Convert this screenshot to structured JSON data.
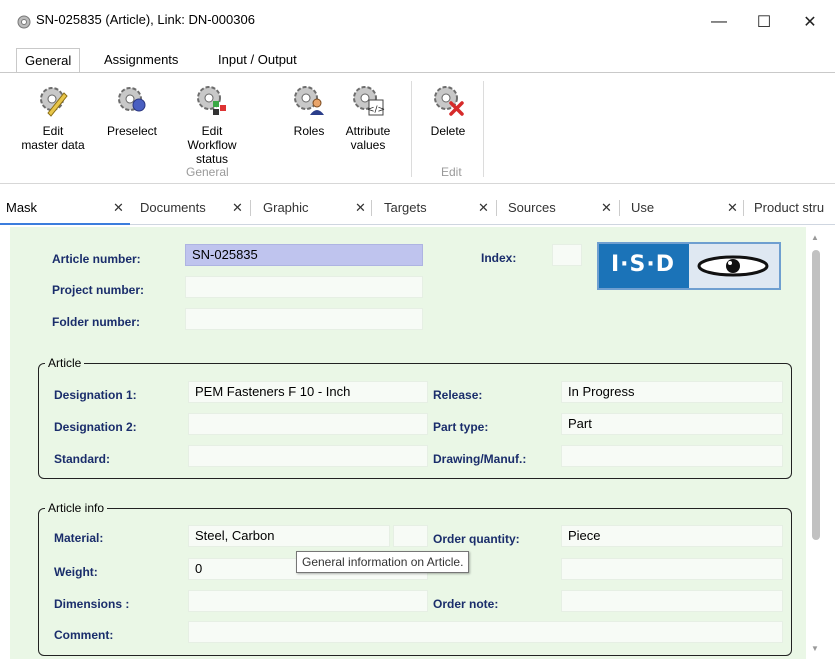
{
  "window": {
    "title": "SN-025835 (Article), Link: DN-000306",
    "minimize_glyph": "—",
    "maximize_glyph": "☐",
    "close_glyph": "✕"
  },
  "ribbon": {
    "tabs": [
      "General",
      "Assignments",
      "Input / Output"
    ],
    "active_tab": "General",
    "groups": [
      {
        "label": "General",
        "buttons": [
          {
            "line1": "Edit",
            "line2": "master data",
            "icon": "edit-master-data-icon"
          },
          {
            "line1": "Preselect",
            "line2": "",
            "icon": "preselect-icon"
          },
          {
            "line1": "Edit",
            "line2": "Workflow status",
            "icon": "workflow-status-icon"
          },
          {
            "line1": "Roles",
            "line2": "",
            "icon": "roles-icon"
          },
          {
            "line1": "Attribute",
            "line2": "values",
            "icon": "attribute-values-icon"
          }
        ]
      },
      {
        "label": "Edit",
        "buttons": [
          {
            "line1": "Delete",
            "line2": "",
            "icon": "delete-icon"
          }
        ]
      }
    ]
  },
  "doc_tabs": {
    "close_glyph": "✕",
    "items": [
      "Mask",
      "Documents",
      "Graphic",
      "Targets",
      "Sources",
      "Use",
      "Product stru"
    ]
  },
  "mask": {
    "header": {
      "article_number_label": "Article number:",
      "article_number_value": "SN-025835",
      "project_number_label": "Project number:",
      "project_number_value": "",
      "folder_number_label": "Folder number:",
      "folder_number_value": "",
      "index_label": "Index:",
      "index_value": ""
    },
    "article": {
      "title": "Article",
      "designation1_label": "Designation 1:",
      "designation1_value": "PEM Fasteners F 10 - Inch",
      "designation2_label": "Designation 2:",
      "designation2_value": "",
      "standard_label": "Standard:",
      "standard_value": "",
      "release_label": "Release:",
      "release_value": "In Progress",
      "part_type_label": "Part type:",
      "part_type_value": "Part",
      "drawing_label": "Drawing/Manuf.:",
      "drawing_value": ""
    },
    "article_info": {
      "title": "Article info",
      "material_label": "Material:",
      "material_value": "Steel, Carbon",
      "weight_label": "Weight:",
      "weight_value": "0",
      "dimensions_label": "Dimensions :",
      "dimensions_value": "",
      "comment_label": "Comment:",
      "comment_value": "",
      "order_quantity_label": "Order quantity:",
      "order_quantity_value": "Piece",
      "order_note_label": "Order note:",
      "order_note_value": ""
    },
    "tooltip": "General information on Article.",
    "logo_text": "I·S·D"
  },
  "colors": {
    "mask_background": "#eaf7e6",
    "label_color": "#1a2d6b",
    "selected_field": "#bfc4ee",
    "logo_blue": "#1b73b8",
    "active_tab_underline": "#3b7ddd"
  }
}
